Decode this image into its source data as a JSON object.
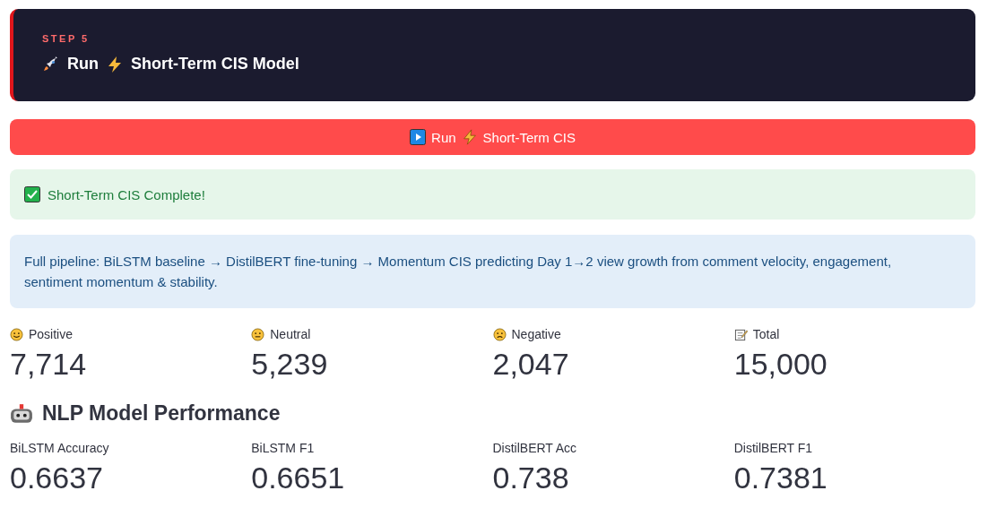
{
  "step_header": {
    "step": "STEP 5",
    "title_parts": [
      "Run",
      "Short-Term CIS Model"
    ]
  },
  "run_button": {
    "label_parts": [
      "Run",
      "Short-Term CIS"
    ]
  },
  "success_alert": {
    "text": "Short-Term CIS Complete!"
  },
  "info_alert": {
    "text": "Full pipeline: BiLSTM baseline → DistilBERT fine-tuning → Momentum CIS predicting Day 1→2 view growth from comment velocity, engagement, sentiment momentum & stability."
  },
  "sentiment_metrics": [
    {
      "kind": "positive",
      "label": "Positive",
      "value": "7,714"
    },
    {
      "kind": "neutral",
      "label": "Neutral",
      "value": "5,239"
    },
    {
      "kind": "negative",
      "label": "Negative",
      "value": "2,047"
    },
    {
      "kind": "total",
      "label": "Total",
      "value": "15,000"
    }
  ],
  "performance_section": {
    "heading": "NLP Model Performance"
  },
  "performance_metrics": [
    {
      "label": "BiLSTM Accuracy",
      "value": "0.6637"
    },
    {
      "label": "BiLSTM F1",
      "value": "0.6651"
    },
    {
      "label": "DistilBERT Acc",
      "value": "0.738"
    },
    {
      "label": "DistilBERT F1",
      "value": "0.7381"
    }
  ]
}
